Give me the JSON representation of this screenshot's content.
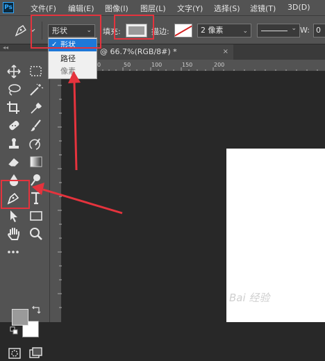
{
  "app": {
    "logo_text": "Ps"
  },
  "menubar": {
    "items": [
      "文件(F)",
      "编辑(E)",
      "图像(I)",
      "图层(L)",
      "文字(Y)",
      "选择(S)",
      "滤镜(T)",
      "3D(D)"
    ]
  },
  "options_bar": {
    "mode_value": "形状",
    "fill_label": "填充:",
    "stroke_label": "描边:",
    "stroke_width_value": "2 像素",
    "width_label": "W:",
    "width_value": "0"
  },
  "mode_dropdown": {
    "options": [
      {
        "label": "形状",
        "selected": true
      },
      {
        "label": "路径",
        "selected": false
      },
      {
        "label": "像素",
        "selected": false,
        "disabled": true
      }
    ]
  },
  "document": {
    "tab_title": "@ 66.7%(RGB/8#) *",
    "close_glyph": "×"
  },
  "ruler": {
    "h_labels": [
      "0",
      "50",
      "100",
      "150",
      "200"
    ]
  },
  "toolbar": {
    "collapse_glyph": "◂◂"
  },
  "watermark": {
    "text": "Bai 经验"
  },
  "colors": {
    "highlight": "#e5333d",
    "selection": "#1e78d8",
    "foreground": "#9a9a9a",
    "background": "#ffffff",
    "panel": "#535353",
    "canvas": "#282828"
  }
}
